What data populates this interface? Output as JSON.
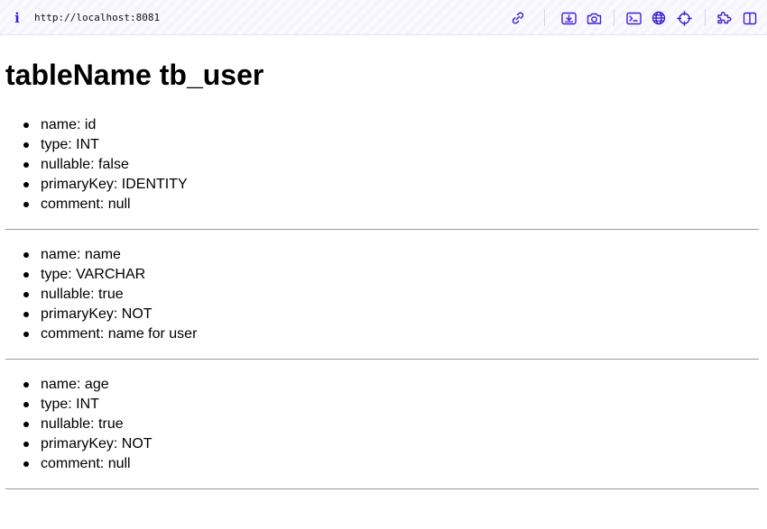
{
  "browser": {
    "url": "http://localhost:8081",
    "info_icon": "info-icon",
    "toolbar_icons": [
      "link-icon",
      "download-card-icon",
      "camera-icon",
      "terminal-icon",
      "globe-icon",
      "crosshair-icon",
      "extension-icon",
      "sidebar-icon"
    ],
    "accent_color": "#3a1fd6"
  },
  "page": {
    "title": "tableName tb_user",
    "columns": [
      {
        "name": "name: id",
        "type": "type: INT",
        "nullable": "nullable: false",
        "primaryKey": "primaryKey: IDENTITY",
        "comment": "comment: null"
      },
      {
        "name": "name: name",
        "type": "type: VARCHAR",
        "nullable": "nullable: true",
        "primaryKey": "primaryKey: NOT",
        "comment": "comment: name for user"
      },
      {
        "name": "name: age",
        "type": "type: INT",
        "nullable": "nullable: true",
        "primaryKey": "primaryKey: NOT",
        "comment": "comment: null"
      }
    ]
  }
}
